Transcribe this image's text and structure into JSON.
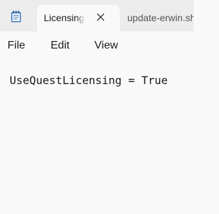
{
  "app": {
    "icon": "notepad-icon"
  },
  "tabs": [
    {
      "title": "Licensing",
      "active": true,
      "close_icon": "close-icon"
    },
    {
      "title": "update-erwin.sh",
      "active": false
    }
  ],
  "menu": {
    "file": "File",
    "edit": "Edit",
    "view": "View"
  },
  "editor": {
    "lines": [
      "UseQuestLicensing = True"
    ]
  },
  "colors": {
    "tabbar_bg": "#ececec",
    "content_bg": "#f9f9f9",
    "icon_blue": "#3a7bbf"
  }
}
